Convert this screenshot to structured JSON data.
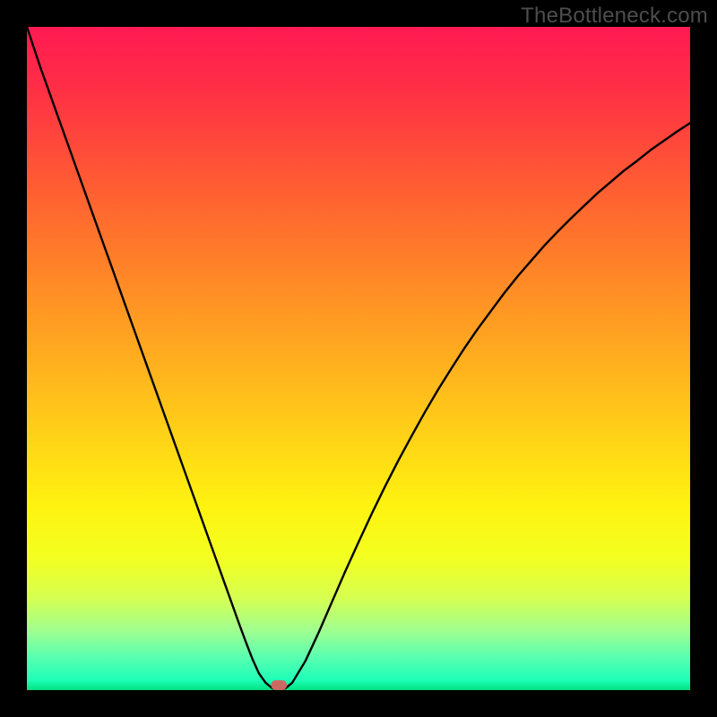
{
  "watermark": "TheBottleneck.com",
  "chart_data": {
    "type": "line",
    "title": "",
    "xlabel": "",
    "ylabel": "",
    "xlim": [
      0,
      100
    ],
    "ylim": [
      0,
      100
    ],
    "x": [
      0,
      1,
      2,
      4,
      6,
      8,
      10,
      12,
      14,
      16,
      18,
      20,
      22,
      24,
      26,
      28,
      30,
      32,
      33,
      34,
      35,
      36,
      37,
      38,
      39,
      40,
      42,
      44,
      46,
      48,
      50,
      52,
      54,
      56,
      58,
      60,
      62,
      64,
      66,
      68,
      70,
      72,
      74,
      76,
      78,
      80,
      82,
      84,
      86,
      88,
      90,
      92,
      94,
      96,
      98,
      100
    ],
    "y": [
      100,
      97,
      94,
      88.4,
      82.8,
      77.2,
      71.6,
      66,
      60.4,
      54.8,
      49.2,
      43.6,
      38,
      32.4,
      26.8,
      21.2,
      15.6,
      10,
      7.3,
      4.7,
      2.5,
      1.1,
      0.28,
      0,
      0.28,
      1.1,
      4.4,
      8.7,
      13.3,
      17.9,
      22.3,
      26.6,
      30.7,
      34.6,
      38.3,
      41.9,
      45.3,
      48.5,
      51.6,
      54.5,
      57.2,
      59.9,
      62.4,
      64.7,
      67,
      69.1,
      71.1,
      73,
      74.9,
      76.6,
      78.3,
      79.8,
      81.4,
      82.8,
      84.2,
      85.5
    ],
    "marker": {
      "x": 38,
      "min": 36.8,
      "max": 39.2
    },
    "gradient_stops": [
      {
        "offset": 0.0,
        "color": "#ff1a52"
      },
      {
        "offset": 0.09,
        "color": "#ff2e46"
      },
      {
        "offset": 0.18,
        "color": "#ff4a3a"
      },
      {
        "offset": 0.27,
        "color": "#ff6630"
      },
      {
        "offset": 0.36,
        "color": "#ff8228"
      },
      {
        "offset": 0.45,
        "color": "#ff9e22"
      },
      {
        "offset": 0.54,
        "color": "#ffba1c"
      },
      {
        "offset": 0.63,
        "color": "#ffd616"
      },
      {
        "offset": 0.72,
        "color": "#fff210"
      },
      {
        "offset": 0.8,
        "color": "#f3ff20"
      },
      {
        "offset": 0.86,
        "color": "#d7ff50"
      },
      {
        "offset": 0.91,
        "color": "#a0ff90"
      },
      {
        "offset": 0.95,
        "color": "#5affb0"
      },
      {
        "offset": 0.985,
        "color": "#1effb8"
      },
      {
        "offset": 1.0,
        "color": "#00e07f"
      }
    ]
  }
}
